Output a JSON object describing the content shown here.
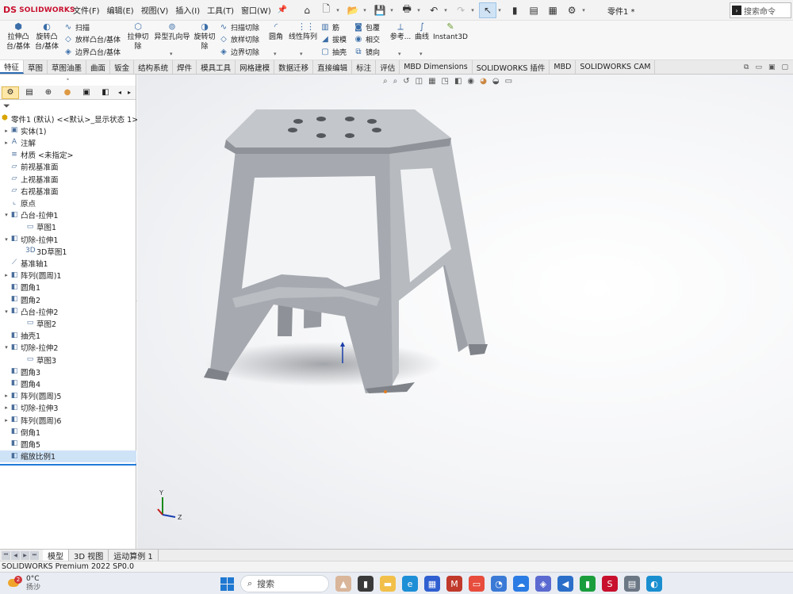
{
  "app": {
    "brand_short": "DS",
    "brand": "SOLIDWORKS",
    "doc_title": "零件1 *"
  },
  "menu": [
    "文件(F)",
    "编辑(E)",
    "视图(V)",
    "插入(I)",
    "工具(T)",
    "窗口(W)"
  ],
  "search_command": {
    "placeholder": "搜索命令"
  },
  "ribbon": {
    "extrude_boss": "拉伸凸\n台/基体",
    "revolve_boss": "旋转凸\n台/基体",
    "sweep": "扫描",
    "loft_boss": "放样凸台/基体",
    "boundary_boss": "边界凸台/基体",
    "extrude_cut": "拉伸切\n除",
    "hole_wizard": "异型孔向导",
    "revolve_cut": "旋转切\n除",
    "sweep_cut": "扫描切除",
    "loft_cut": "放样切除",
    "boundary_cut": "边界切除",
    "fillet": "圆角",
    "linear_pattern": "线性阵列",
    "rib": "筋",
    "draft": "拔模",
    "shell": "抽壳",
    "wrap": "包覆",
    "intersect": "相交",
    "mirror": "镜向",
    "reference": "参考...",
    "curves": "曲线",
    "instant3d": "Instant3D"
  },
  "tabs": [
    "特征",
    "草图",
    "草图油墨",
    "曲面",
    "钣金",
    "结构系统",
    "焊件",
    "模具工具",
    "网格建模",
    "数据迁移",
    "直接编辑",
    "标注",
    "评估",
    "MBD Dimensions",
    "SOLIDWORKS 插件",
    "MBD",
    "SOLIDWORKS CAM"
  ],
  "active_tab": "特征",
  "tree": {
    "root": "零件1 (默认) <<默认>_显示状态 1>",
    "items": [
      {
        "label": "实体(1)",
        "exp": "▸",
        "indent": 0
      },
      {
        "label": "注解",
        "exp": "▸",
        "indent": 0
      },
      {
        "label": "材质 <未指定>",
        "exp": "",
        "indent": 0
      },
      {
        "label": "前视基准面",
        "exp": "",
        "indent": 0
      },
      {
        "label": "上视基准面",
        "exp": "",
        "indent": 0
      },
      {
        "label": "右视基准面",
        "exp": "",
        "indent": 0
      },
      {
        "label": "原点",
        "exp": "",
        "indent": 0
      },
      {
        "label": "凸台-拉伸1",
        "exp": "▾",
        "indent": 0
      },
      {
        "label": "草图1",
        "exp": "",
        "indent": 1
      },
      {
        "label": "切除-拉伸1",
        "exp": "▾",
        "indent": 0
      },
      {
        "label": "3D草图1",
        "exp": "",
        "indent": 1
      },
      {
        "label": "基准轴1",
        "exp": "",
        "indent": 0
      },
      {
        "label": "阵列(圆周)1",
        "exp": "▸",
        "indent": 0
      },
      {
        "label": "圆角1",
        "exp": "",
        "indent": 0
      },
      {
        "label": "圆角2",
        "exp": "",
        "indent": 0
      },
      {
        "label": "凸台-拉伸2",
        "exp": "▾",
        "indent": 0
      },
      {
        "label": "草图2",
        "exp": "",
        "indent": 1
      },
      {
        "label": "抽壳1",
        "exp": "",
        "indent": 0
      },
      {
        "label": "切除-拉伸2",
        "exp": "▾",
        "indent": 0
      },
      {
        "label": "草图3",
        "exp": "",
        "indent": 1
      },
      {
        "label": "圆角3",
        "exp": "",
        "indent": 0
      },
      {
        "label": "圆角4",
        "exp": "",
        "indent": 0
      },
      {
        "label": "阵列(圆周)5",
        "exp": "▸",
        "indent": 0
      },
      {
        "label": "切除-拉伸3",
        "exp": "▸",
        "indent": 0
      },
      {
        "label": "阵列(圆周)6",
        "exp": "▸",
        "indent": 0
      },
      {
        "label": "倒角1",
        "exp": "",
        "indent": 0
      },
      {
        "label": "圆角5",
        "exp": "",
        "indent": 0
      },
      {
        "label": "缩放比例1",
        "exp": "",
        "indent": 0,
        "selected": true
      }
    ]
  },
  "triad": {
    "y": "Y",
    "z": "Z"
  },
  "bottom_tabs": [
    "模型",
    "3D 视图",
    "运动算例 1"
  ],
  "status": "SOLIDWORKS Premium 2022 SP0.0",
  "taskbar": {
    "temp": "0°C",
    "weather": "扬沙",
    "badge": "2",
    "search": "搜索"
  },
  "colors": {
    "brand": "#c8102e",
    "selection": "#cfe3f7",
    "model": "#a9adb3"
  }
}
